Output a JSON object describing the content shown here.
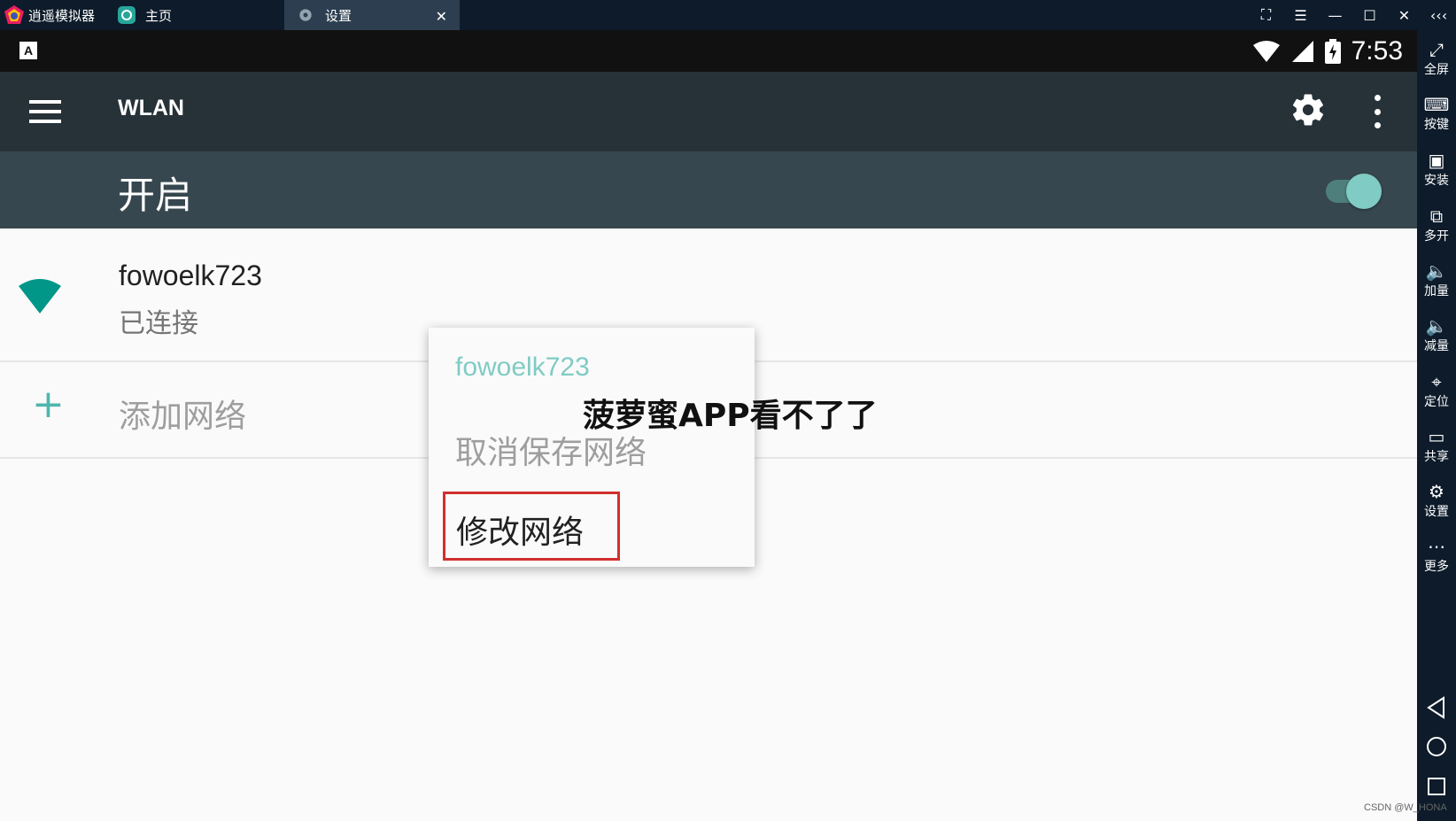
{
  "titlebar": {
    "app_name": "逍遥模拟器",
    "tabs": [
      {
        "label": "主页"
      },
      {
        "label": "设置"
      }
    ],
    "close_tab_glyph": "✕",
    "controls": [
      "⛶",
      "☰",
      "—",
      "☐",
      "✕",
      "‹‹‹"
    ]
  },
  "statusbar": {
    "left_icon": "A",
    "time": "7:53"
  },
  "toolbar": {
    "title": "WLAN"
  },
  "switchbar": {
    "label": "开启",
    "on": true
  },
  "networks": [
    {
      "name": "fowoelk723",
      "status": "已连接"
    }
  ],
  "add_network": {
    "icon": "+",
    "label": "添加网络"
  },
  "popup": {
    "title": "fowoelk723",
    "items": [
      "取消保存网络",
      "修改网络"
    ]
  },
  "overlay_text": "菠萝蜜APP看不了了",
  "sidebar": {
    "items": [
      {
        "icon": "⤢",
        "label": "全屏"
      },
      {
        "icon": "⌨",
        "label": "按键"
      },
      {
        "icon": "▣",
        "label": "安装"
      },
      {
        "icon": "⧉",
        "label": "多开"
      },
      {
        "icon": "🔈",
        "label": "加量"
      },
      {
        "icon": "🔈",
        "label": "减量"
      },
      {
        "icon": "⌖",
        "label": "定位"
      },
      {
        "icon": "▭",
        "label": "共享"
      },
      {
        "icon": "⚙",
        "label": "设置"
      },
      {
        "icon": "⋯",
        "label": "更多"
      }
    ]
  },
  "watermark": "CSDN @W_HONA",
  "colors": {
    "toolbar": "#263238",
    "switchbar": "#37474f",
    "accent": "#80cbc4",
    "wifi_icon": "#009688",
    "highlight_border": "#d32f2f"
  }
}
